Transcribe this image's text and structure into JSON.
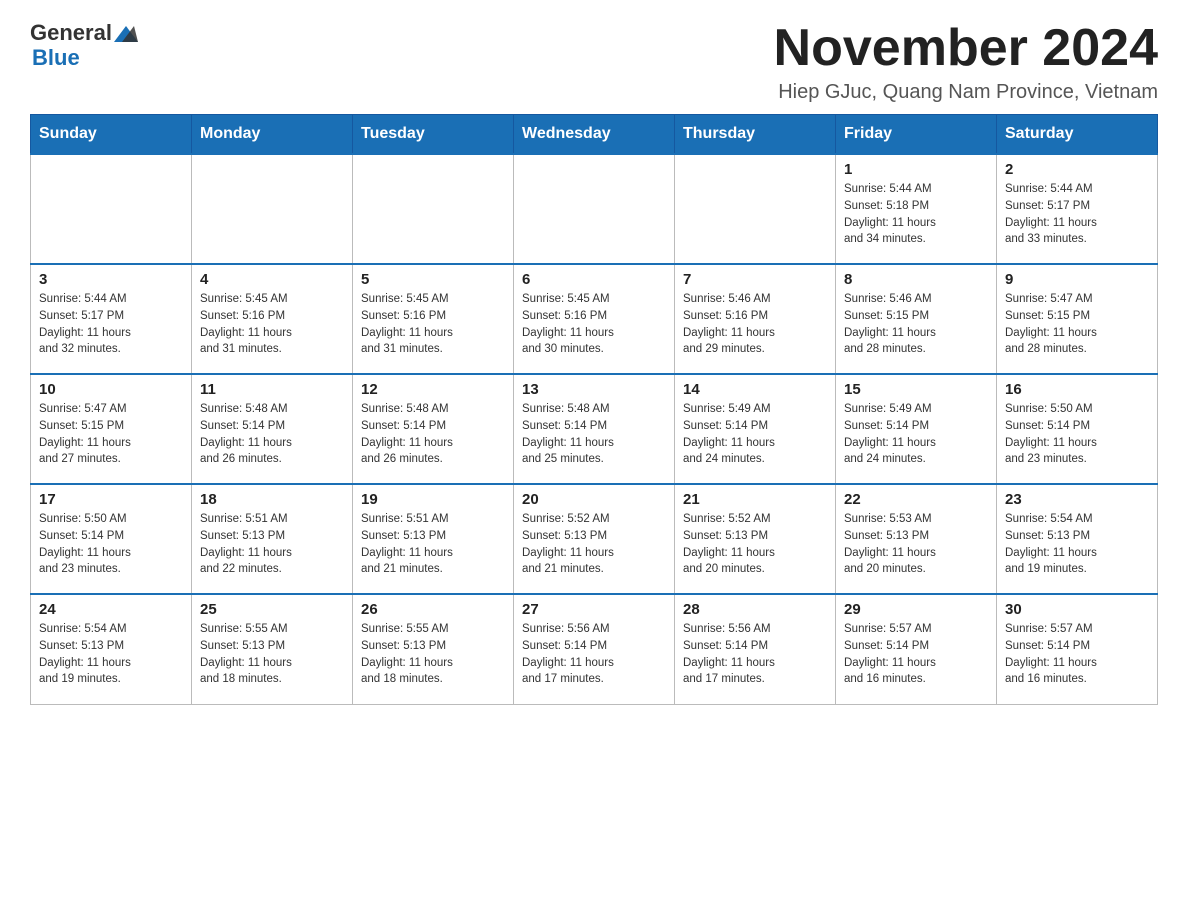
{
  "header": {
    "logo_general": "General",
    "logo_blue": "Blue",
    "month_title": "November 2024",
    "location": "Hiep GJuc, Quang Nam Province, Vietnam"
  },
  "days_of_week": [
    "Sunday",
    "Monday",
    "Tuesday",
    "Wednesday",
    "Thursday",
    "Friday",
    "Saturday"
  ],
  "weeks": [
    [
      {
        "day": "",
        "info": ""
      },
      {
        "day": "",
        "info": ""
      },
      {
        "day": "",
        "info": ""
      },
      {
        "day": "",
        "info": ""
      },
      {
        "day": "",
        "info": ""
      },
      {
        "day": "1",
        "info": "Sunrise: 5:44 AM\nSunset: 5:18 PM\nDaylight: 11 hours\nand 34 minutes."
      },
      {
        "day": "2",
        "info": "Sunrise: 5:44 AM\nSunset: 5:17 PM\nDaylight: 11 hours\nand 33 minutes."
      }
    ],
    [
      {
        "day": "3",
        "info": "Sunrise: 5:44 AM\nSunset: 5:17 PM\nDaylight: 11 hours\nand 32 minutes."
      },
      {
        "day": "4",
        "info": "Sunrise: 5:45 AM\nSunset: 5:16 PM\nDaylight: 11 hours\nand 31 minutes."
      },
      {
        "day": "5",
        "info": "Sunrise: 5:45 AM\nSunset: 5:16 PM\nDaylight: 11 hours\nand 31 minutes."
      },
      {
        "day": "6",
        "info": "Sunrise: 5:45 AM\nSunset: 5:16 PM\nDaylight: 11 hours\nand 30 minutes."
      },
      {
        "day": "7",
        "info": "Sunrise: 5:46 AM\nSunset: 5:16 PM\nDaylight: 11 hours\nand 29 minutes."
      },
      {
        "day": "8",
        "info": "Sunrise: 5:46 AM\nSunset: 5:15 PM\nDaylight: 11 hours\nand 28 minutes."
      },
      {
        "day": "9",
        "info": "Sunrise: 5:47 AM\nSunset: 5:15 PM\nDaylight: 11 hours\nand 28 minutes."
      }
    ],
    [
      {
        "day": "10",
        "info": "Sunrise: 5:47 AM\nSunset: 5:15 PM\nDaylight: 11 hours\nand 27 minutes."
      },
      {
        "day": "11",
        "info": "Sunrise: 5:48 AM\nSunset: 5:14 PM\nDaylight: 11 hours\nand 26 minutes."
      },
      {
        "day": "12",
        "info": "Sunrise: 5:48 AM\nSunset: 5:14 PM\nDaylight: 11 hours\nand 26 minutes."
      },
      {
        "day": "13",
        "info": "Sunrise: 5:48 AM\nSunset: 5:14 PM\nDaylight: 11 hours\nand 25 minutes."
      },
      {
        "day": "14",
        "info": "Sunrise: 5:49 AM\nSunset: 5:14 PM\nDaylight: 11 hours\nand 24 minutes."
      },
      {
        "day": "15",
        "info": "Sunrise: 5:49 AM\nSunset: 5:14 PM\nDaylight: 11 hours\nand 24 minutes."
      },
      {
        "day": "16",
        "info": "Sunrise: 5:50 AM\nSunset: 5:14 PM\nDaylight: 11 hours\nand 23 minutes."
      }
    ],
    [
      {
        "day": "17",
        "info": "Sunrise: 5:50 AM\nSunset: 5:14 PM\nDaylight: 11 hours\nand 23 minutes."
      },
      {
        "day": "18",
        "info": "Sunrise: 5:51 AM\nSunset: 5:13 PM\nDaylight: 11 hours\nand 22 minutes."
      },
      {
        "day": "19",
        "info": "Sunrise: 5:51 AM\nSunset: 5:13 PM\nDaylight: 11 hours\nand 21 minutes."
      },
      {
        "day": "20",
        "info": "Sunrise: 5:52 AM\nSunset: 5:13 PM\nDaylight: 11 hours\nand 21 minutes."
      },
      {
        "day": "21",
        "info": "Sunrise: 5:52 AM\nSunset: 5:13 PM\nDaylight: 11 hours\nand 20 minutes."
      },
      {
        "day": "22",
        "info": "Sunrise: 5:53 AM\nSunset: 5:13 PM\nDaylight: 11 hours\nand 20 minutes."
      },
      {
        "day": "23",
        "info": "Sunrise: 5:54 AM\nSunset: 5:13 PM\nDaylight: 11 hours\nand 19 minutes."
      }
    ],
    [
      {
        "day": "24",
        "info": "Sunrise: 5:54 AM\nSunset: 5:13 PM\nDaylight: 11 hours\nand 19 minutes."
      },
      {
        "day": "25",
        "info": "Sunrise: 5:55 AM\nSunset: 5:13 PM\nDaylight: 11 hours\nand 18 minutes."
      },
      {
        "day": "26",
        "info": "Sunrise: 5:55 AM\nSunset: 5:13 PM\nDaylight: 11 hours\nand 18 minutes."
      },
      {
        "day": "27",
        "info": "Sunrise: 5:56 AM\nSunset: 5:14 PM\nDaylight: 11 hours\nand 17 minutes."
      },
      {
        "day": "28",
        "info": "Sunrise: 5:56 AM\nSunset: 5:14 PM\nDaylight: 11 hours\nand 17 minutes."
      },
      {
        "day": "29",
        "info": "Sunrise: 5:57 AM\nSunset: 5:14 PM\nDaylight: 11 hours\nand 16 minutes."
      },
      {
        "day": "30",
        "info": "Sunrise: 5:57 AM\nSunset: 5:14 PM\nDaylight: 11 hours\nand 16 minutes."
      }
    ]
  ]
}
